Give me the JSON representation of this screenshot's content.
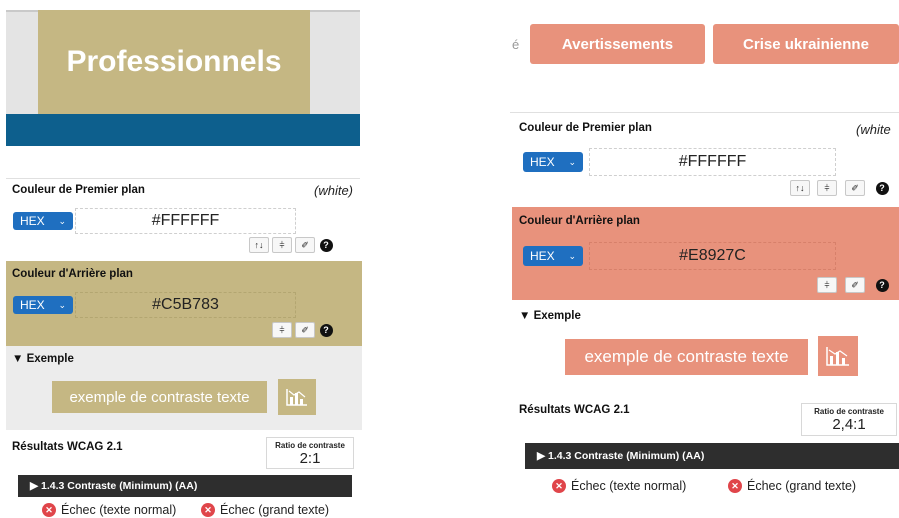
{
  "left": {
    "banner_title": "Professionnels",
    "foreground": {
      "label": "Couleur de Premier plan",
      "name_note": "(white)",
      "format": "HEX",
      "value": "#FFFFFF"
    },
    "background": {
      "label": "Couleur d'Arrière plan",
      "format": "HEX",
      "value": "#C5B783",
      "color": "#c5b783"
    },
    "example": {
      "heading": "▼ Exemple",
      "sample_text": "exemple de contraste texte"
    },
    "results": {
      "heading": "Résultats WCAG 2.1",
      "ratio_label": "Ratio de contraste",
      "ratio_value": "2:1",
      "criterion": "▶ 1.4.3 Contraste (Minimum) (AA)",
      "fail_normal": "Échec (texte normal)",
      "fail_large": "Échec (grand texte)"
    }
  },
  "right": {
    "leading_char": "é",
    "buttons": [
      "Avertissements",
      "Crise ukrainienne"
    ],
    "foreground": {
      "label": "Couleur de Premier plan",
      "name_note": "(white",
      "format": "HEX",
      "value": "#FFFFFF"
    },
    "background": {
      "label": "Couleur d'Arrière plan",
      "format": "HEX",
      "value": "#E8927C",
      "color": "#e8927c"
    },
    "example": {
      "heading": "▼ Exemple",
      "sample_text": "exemple de contraste texte"
    },
    "results": {
      "heading": "Résultats WCAG 2.1",
      "ratio_label": "Ratio de contraste",
      "ratio_value": "2,4:1",
      "criterion": "▶ 1.4.3 Contraste (Minimum) (AA)",
      "fail_normal": "Échec (texte normal)",
      "fail_large": "Échec (grand texte)"
    }
  },
  "icons": {
    "swap": "↑↓",
    "sliders": "⫩",
    "eyedropper": "✐",
    "help": "?",
    "fail": "✕",
    "chevron": "⌄"
  },
  "colors": {
    "hex_select": "#1f6fc0",
    "banner_blue": "#0d5f8d",
    "criteria_bar": "#2e2e2e",
    "fail_red": "#e0454a"
  }
}
